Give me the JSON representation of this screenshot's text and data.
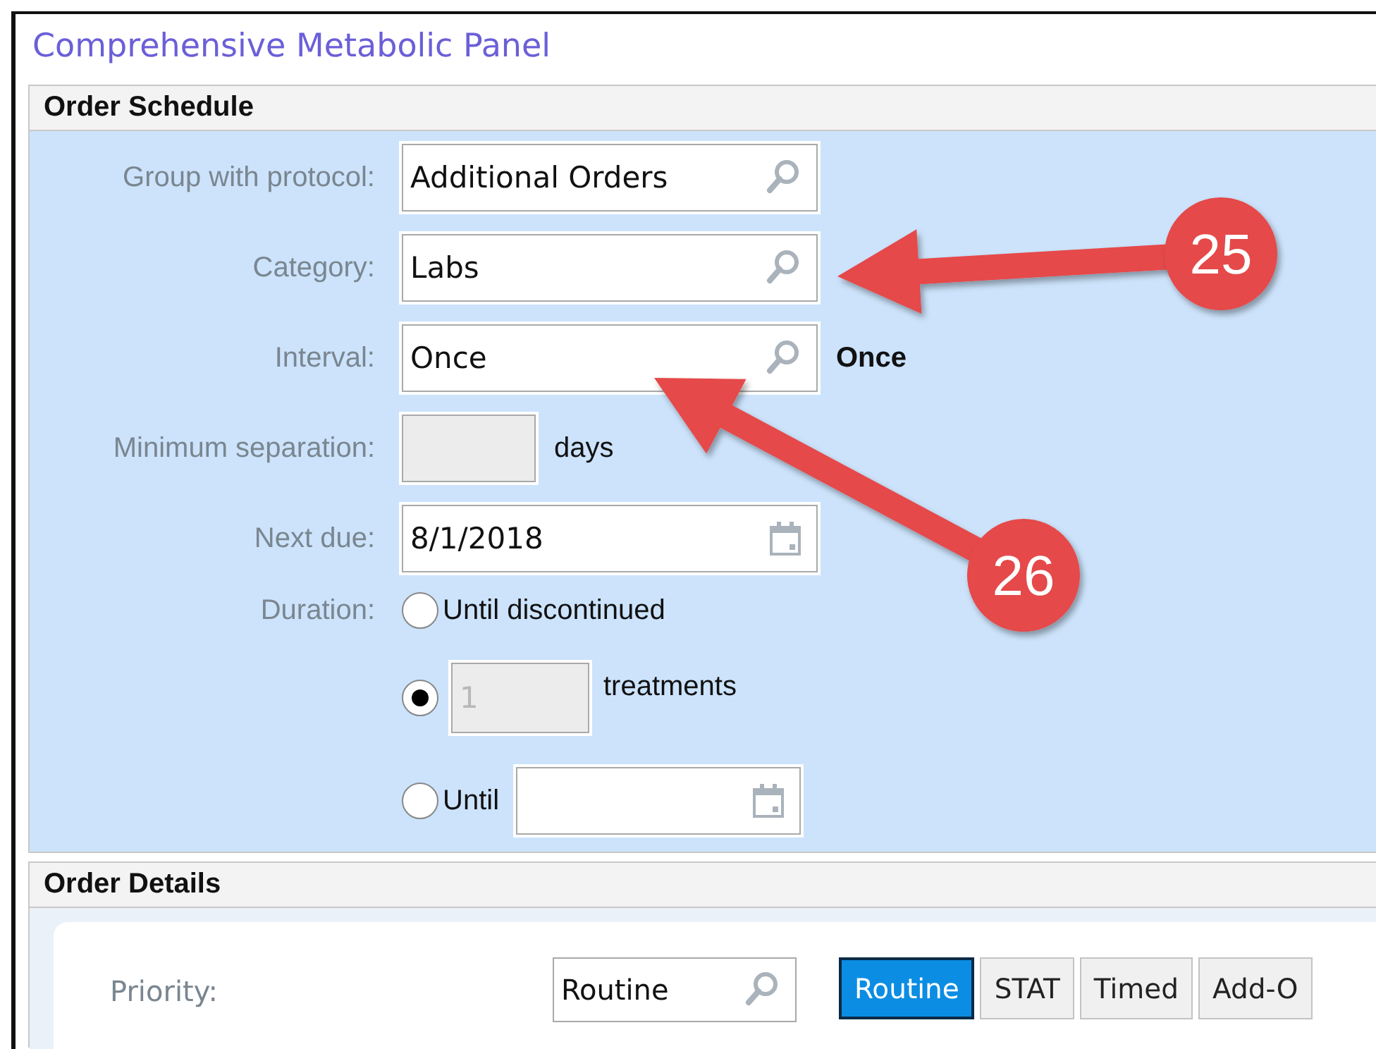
{
  "title": "Comprehensive Metabolic Panel",
  "order_schedule": {
    "heading": "Order Schedule",
    "fields": [
      {
        "label": "Group with protocol:",
        "kind": "lookup",
        "value": "Additional Orders"
      },
      {
        "label": "Category:",
        "kind": "lookup",
        "value": "Labs"
      },
      {
        "label": "Interval:",
        "kind": "lookup",
        "value": "Once",
        "note": "Once"
      },
      {
        "label": "Minimum separation:",
        "kind": "number",
        "suffix": "days",
        "disabled": true
      },
      {
        "label": "Next due:",
        "kind": "date",
        "value": "8/1/2018"
      }
    ],
    "duration": {
      "label": "Duration:",
      "options": [
        {
          "kind": "plain",
          "label": "Until discontinued",
          "selected": false
        },
        {
          "kind": "count",
          "value": "1",
          "suffix": "treatments",
          "disabled": true,
          "selected": true
        },
        {
          "kind": "date",
          "label": "Until",
          "selected": false
        }
      ]
    }
  },
  "order_details": {
    "heading": "Order Details",
    "priority": {
      "label": "Priority:",
      "value": "Routine",
      "options": [
        {
          "label": "Routine",
          "selected": true
        },
        {
          "label": "STAT",
          "selected": false
        },
        {
          "label": "Timed",
          "selected": false
        },
        {
          "label": "Add-O",
          "selected": false
        }
      ]
    }
  },
  "callouts": [
    {
      "number": "25"
    },
    {
      "number": "26"
    }
  ]
}
